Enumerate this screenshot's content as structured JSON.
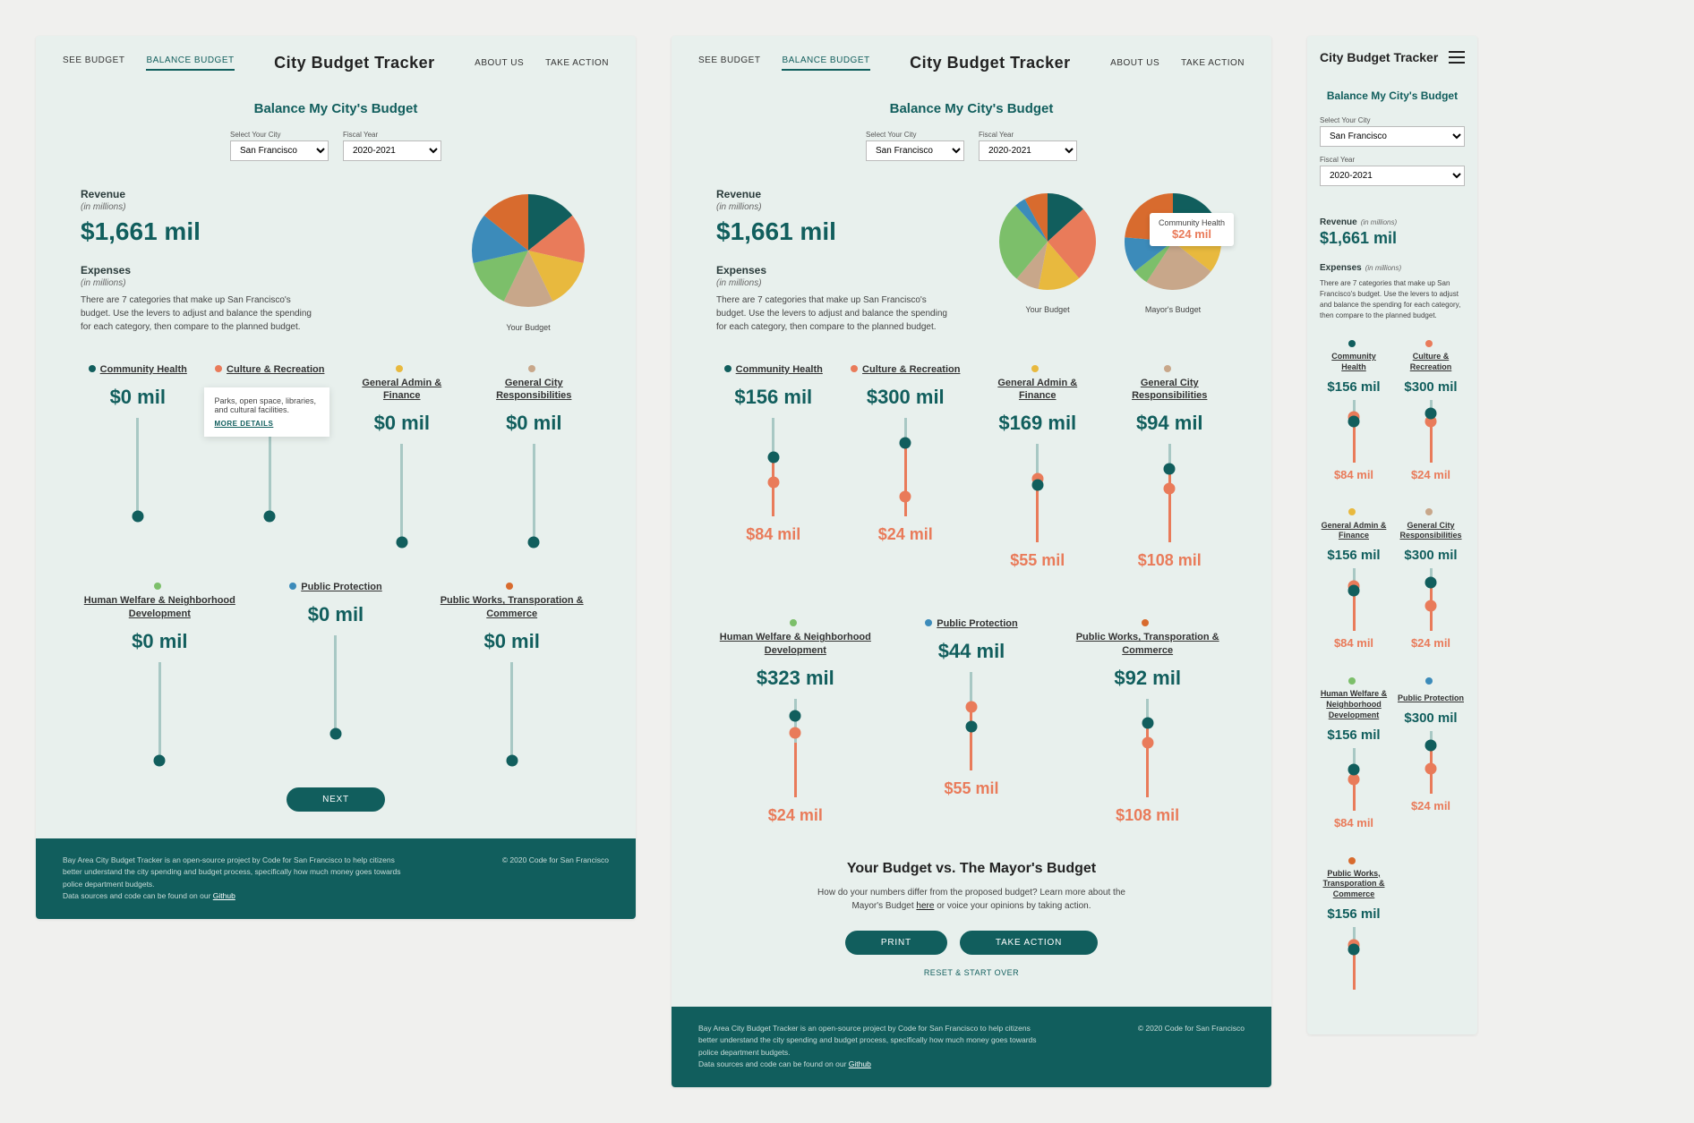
{
  "nav": {
    "see_budget": "SEE BUDGET",
    "balance_budget": "BALANCE BUDGET",
    "brand": "City Budget Tracker",
    "about": "ABOUT US",
    "take_action": "TAKE ACTION"
  },
  "title": "Balance My City's Budget",
  "selectors": {
    "city_label": "Select Your City",
    "city_value": "San Francisco",
    "year_label": "Fiscal Year",
    "year_value": "2020-2021"
  },
  "revenue": {
    "label": "Revenue",
    "unit": "(in millions)",
    "value": "$1,661 mil"
  },
  "expenses": {
    "label": "Expenses",
    "unit": "(in millions)",
    "description": "There are 7 categories that make up San Francisco's budget. Use the levers to adjust and balance the spending for each category, then compare to the planned budget."
  },
  "pie_captions": {
    "your": "Your Budget",
    "mayor": "Mayor's Budget"
  },
  "pie_tooltip": {
    "label": "Community Health",
    "value": "$24 mil"
  },
  "hint": {
    "text": "Parks, open space, libraries, and cultural facilities.",
    "more": "MORE DETAILS"
  },
  "colors": {
    "teal": "#115e5d",
    "orange": "#e97b5a",
    "green": "#4aa24a",
    "yellow": "#e8b93e",
    "tan": "#c8a78a",
    "dorange": "#d86b2e",
    "blue": "#3c8bba",
    "ltgreen": "#7cbf6a"
  },
  "categories_zero": [
    {
      "name": "Community Health",
      "color": "#115e5d",
      "value": "$0 mil"
    },
    {
      "name": "Culture & Recreation",
      "color": "#e97b5a",
      "value": "$0 mil"
    },
    {
      "name": "General Admin & Finance",
      "color": "#e8b93e",
      "value": "$0 mil"
    },
    {
      "name": "General City Responsibilities",
      "color": "#c8a78a",
      "value": "$0 mil"
    },
    {
      "name": "Human Welfare & Neighborhood Development",
      "color": "#7cbf6a",
      "value": "$0 mil"
    },
    {
      "name": "Public Protection",
      "color": "#3c8bba",
      "value": "$0 mil"
    },
    {
      "name": "Public Works, Transporation & Commerce",
      "color": "#d86b2e",
      "value": "$0 mil"
    }
  ],
  "categories_filled": [
    {
      "name": "Community Health",
      "color": "#115e5d",
      "top_val": "$156 mil",
      "bot_val": "$84 mil",
      "teal_pos": 40,
      "orange_pos": 65,
      "fill": 60
    },
    {
      "name": "Culture & Recreation",
      "color": "#e97b5a",
      "top_val": "$300 mil",
      "bot_val": "$24 mil",
      "teal_pos": 25,
      "orange_pos": 80,
      "fill": 75
    },
    {
      "name": "General Admin & Finance",
      "color": "#e8b93e",
      "top_val": "$169 mil",
      "bot_val": "$55 mil",
      "teal_pos": 42,
      "orange_pos": 35,
      "fill": 60
    },
    {
      "name": "General City Responsibilities",
      "color": "#c8a78a",
      "top_val": "$94 mil",
      "bot_val": "$108 mil",
      "teal_pos": 25,
      "orange_pos": 45,
      "fill": 75
    },
    {
      "name": "Human Welfare & Neighborhood Development",
      "color": "#7cbf6a",
      "top_val": "$323 mil",
      "bot_val": "$24 mil",
      "teal_pos": 18,
      "orange_pos": 35,
      "fill": 55
    },
    {
      "name": "Public Protection",
      "color": "#3c8bba",
      "top_val": "$44 mil",
      "bot_val": "$55 mil",
      "teal_pos": 55,
      "orange_pos": 35,
      "fill": 65
    },
    {
      "name": "Public Works, Transporation & Commerce",
      "color": "#d86b2e",
      "top_val": "$92 mil",
      "bot_val": "$108 mil",
      "teal_pos": 25,
      "orange_pos": 45,
      "fill": 75
    }
  ],
  "categories_mobile": [
    {
      "name": "Community Health",
      "color": "#115e5d",
      "top_val": "$156 mil",
      "bot_val": "$84 mil",
      "teal_pos": 35,
      "orange_pos": 28,
      "fill": 65
    },
    {
      "name": "Culture & Recreation",
      "color": "#e97b5a",
      "top_val": "$300 mil",
      "bot_val": "$24 mil",
      "teal_pos": 22,
      "orange_pos": 35,
      "fill": 75
    },
    {
      "name": "General Admin & Finance",
      "color": "#e8b93e",
      "top_val": "$156 mil",
      "bot_val": "$84 mil",
      "teal_pos": 35,
      "orange_pos": 28,
      "fill": 65
    },
    {
      "name": "General City Responsibilities",
      "color": "#c8a78a",
      "top_val": "$300 mil",
      "bot_val": "$24 mil",
      "teal_pos": 22,
      "orange_pos": 60,
      "fill": 78
    },
    {
      "name": "Human Welfare & Neighborhood Development",
      "color": "#7cbf6a",
      "top_val": "$156 mil",
      "bot_val": "$84 mil",
      "teal_pos": 35,
      "orange_pos": 50,
      "fill": 65
    },
    {
      "name": "Public Protection",
      "color": "#3c8bba",
      "top_val": "$300 mil",
      "bot_val": "$24 mil",
      "teal_pos": 22,
      "orange_pos": 60,
      "fill": 78
    },
    {
      "name": "Public Works, Transporation & Commerce",
      "color": "#d86b2e",
      "top_val": "$156 mil",
      "bot_val": "",
      "teal_pos": 35,
      "orange_pos": 28,
      "fill": 65
    }
  ],
  "next_btn": "NEXT",
  "compare": {
    "title": "Your Budget vs. The Mayor's Budget",
    "sub1": "How do your numbers differ from the proposed budget? Learn more about the Mayor's Budget",
    "sub_link": "here",
    "sub2": " or voice your opinions by taking action.",
    "print": "PRINT",
    "action": "TAKE ACTION",
    "reset": "RESET & START OVER"
  },
  "footer": {
    "line1": "Bay Area City Budget Tracker is an open-source project by Code for San Francisco to help citizens better understand the city spending and budget process, specifically how much money goes towards police department budgets.",
    "line2_a": "Data sources and code can be found on our ",
    "line2_link": "Github",
    "copyright": "© 2020 Code for San Francisco"
  },
  "chart_data": {
    "type": "pie",
    "title": "Budget allocation",
    "series": [
      {
        "name": "Your Budget (empty state)",
        "labels": [
          "Community Health",
          "Culture & Recreation",
          "General Admin & Finance",
          "General City Responsibilities",
          "Human Welfare & Neighborhood Development",
          "Public Protection",
          "Public Works, Transporation & Commerce"
        ],
        "values": [
          1,
          1,
          1,
          1,
          1,
          1,
          1
        ],
        "colors": [
          "#115e5d",
          "#e97b5a",
          "#e8b93e",
          "#c8a78a",
          "#7cbf6a",
          "#3c8bba",
          "#d86b2e"
        ]
      },
      {
        "name": "Your Budget",
        "labels": [
          "Community Health",
          "Culture & Recreation",
          "General Admin & Finance",
          "General City Responsibilities",
          "Human Welfare & Neighborhood Development",
          "Public Protection",
          "Public Works, Transporation & Commerce"
        ],
        "values": [
          156,
          300,
          169,
          94,
          323,
          44,
          92
        ],
        "colors": [
          "#115e5d",
          "#e97b5a",
          "#e8b93e",
          "#c8a78a",
          "#7cbf6a",
          "#3c8bba",
          "#d86b2e"
        ]
      },
      {
        "name": "Mayor's Budget",
        "labels": [
          "Community Health",
          "Culture & Recreation",
          "General Admin & Finance",
          "General City Responsibilities",
          "Human Welfare & Neighborhood Development",
          "Public Protection",
          "Public Works, Transporation & Commerce"
        ],
        "values": [
          84,
          24,
          55,
          108,
          24,
          55,
          108
        ],
        "colors": [
          "#115e5d",
          "#e97b5a",
          "#e8b93e",
          "#c8a78a",
          "#7cbf6a",
          "#3c8bba",
          "#d86b2e"
        ]
      }
    ]
  }
}
